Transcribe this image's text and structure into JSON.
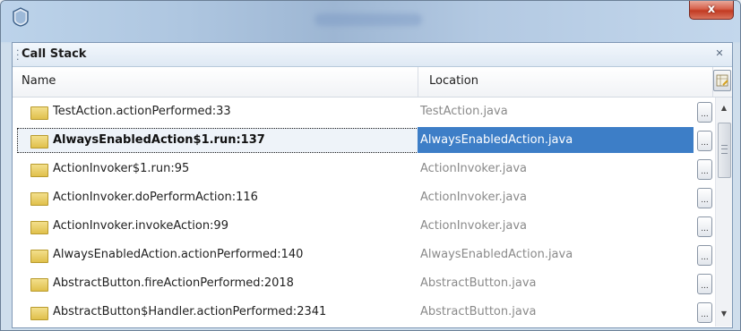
{
  "window": {
    "app_icon": "shield-icon",
    "close_label": "x"
  },
  "panel": {
    "title": "Call Stack",
    "close_glyph": "✕"
  },
  "columns": {
    "name": "Name",
    "location": "Location"
  },
  "rows": [
    {
      "name": "TestAction.actionPerformed:33",
      "location": "TestAction.java",
      "selected": false
    },
    {
      "name": "AlwaysEnabledAction$1.run:137",
      "location": "AlwaysEnabledAction.java",
      "selected": true
    },
    {
      "name": "ActionInvoker$1.run:95",
      "location": "ActionInvoker.java",
      "selected": false
    },
    {
      "name": "ActionInvoker.doPerformAction:116",
      "location": "ActionInvoker.java",
      "selected": false
    },
    {
      "name": "ActionInvoker.invokeAction:99",
      "location": "ActionInvoker.java",
      "selected": false
    },
    {
      "name": "AlwaysEnabledAction.actionPerformed:140",
      "location": "AlwaysEnabledAction.java",
      "selected": false
    },
    {
      "name": "AbstractButton.fireActionPerformed:2018",
      "location": "AbstractButton.java",
      "selected": false
    },
    {
      "name": "AbstractButton$Handler.actionPerformed:2341",
      "location": "AbstractButton.java",
      "selected": false
    }
  ],
  "ellipsis_label": "...",
  "colors": {
    "selection": "#3d7ec7",
    "folder": "#e6c85a",
    "close_button": "#c9452d"
  }
}
